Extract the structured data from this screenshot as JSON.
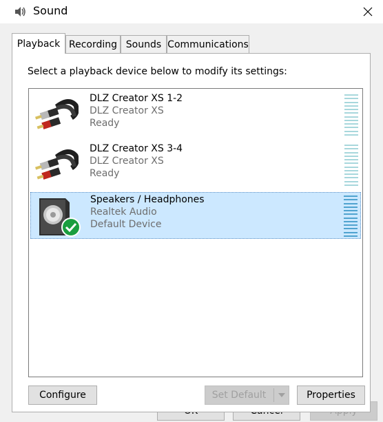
{
  "window": {
    "title": "Sound",
    "icon": "speaker-icon",
    "close_icon": "close-icon"
  },
  "tabs": [
    {
      "label": "Playback",
      "active": true
    },
    {
      "label": "Recording",
      "active": false
    },
    {
      "label": "Sounds",
      "active": false
    },
    {
      "label": "Communications",
      "active": false
    }
  ],
  "playback": {
    "instruction": "Select a playback device below to modify its settings:",
    "devices": [
      {
        "name": "DLZ Creator XS 1-2",
        "description": "DLZ Creator XS",
        "status": "Ready",
        "icon": "rca-cable-icon",
        "selected": false,
        "is_default": false
      },
      {
        "name": "DLZ Creator XS 3-4",
        "description": "DLZ Creator XS",
        "status": "Ready",
        "icon": "rca-cable-icon",
        "selected": false,
        "is_default": false
      },
      {
        "name": "Speakers / Headphones",
        "description": "Realtek Audio",
        "status": "Default Device",
        "icon": "speaker-icon",
        "selected": true,
        "is_default": true
      }
    ],
    "buttons": {
      "configure": "Configure",
      "set_default": "Set Default",
      "properties": "Properties"
    }
  },
  "footer": {
    "ok": "OK",
    "cancel": "Cancel",
    "apply": "Apply"
  },
  "colors": {
    "selection_bg": "#cce8ff",
    "meter_idle": "#a7d7dc",
    "default_check": "#1a9e3f",
    "dialog_bg": "#f0f0f0"
  }
}
